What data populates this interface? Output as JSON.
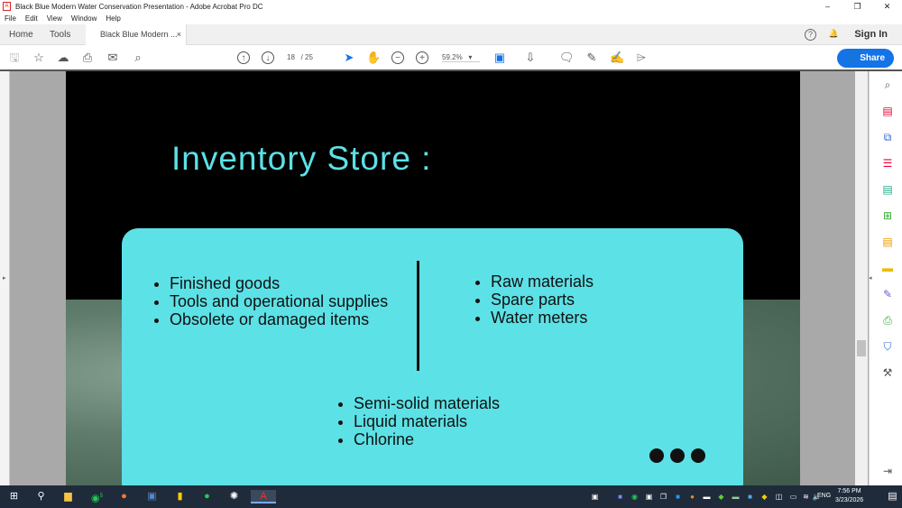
{
  "window": {
    "title": "Black Blue Modern Water Conservation Presentation - Adobe Acrobat Pro DC",
    "minimize": "–",
    "maximize": "❐",
    "close": "✕"
  },
  "menu": [
    "File",
    "Edit",
    "View",
    "Window",
    "Help"
  ],
  "tabs": {
    "home": "Home",
    "tools": "Tools",
    "document": "Black Blue Modern ...",
    "close": "×",
    "help": "?",
    "sign_in": "Sign In"
  },
  "toolbar": {
    "current_page": "18",
    "total_pages": "/ 25",
    "zoom": "59.2%",
    "share": "Share"
  },
  "slide": {
    "title": "Inventory  Store :",
    "left_list": [
      "Finished goods",
      "Tools and operational supplies",
      "Obsolete or damaged items"
    ],
    "right_list": [
      "Raw materials",
      "Spare parts",
      "Water meters"
    ],
    "bottom_list": [
      "Semi-solid materials",
      "Liquid materials",
      "Chlorine"
    ]
  },
  "taskbar": {
    "time": "7:56 PM",
    "date": "3/23/2026",
    "language": "ENG",
    "whatsapp_badge": "5"
  },
  "colors": {
    "accent": "#5ce1e6",
    "share": "#1473e6"
  }
}
